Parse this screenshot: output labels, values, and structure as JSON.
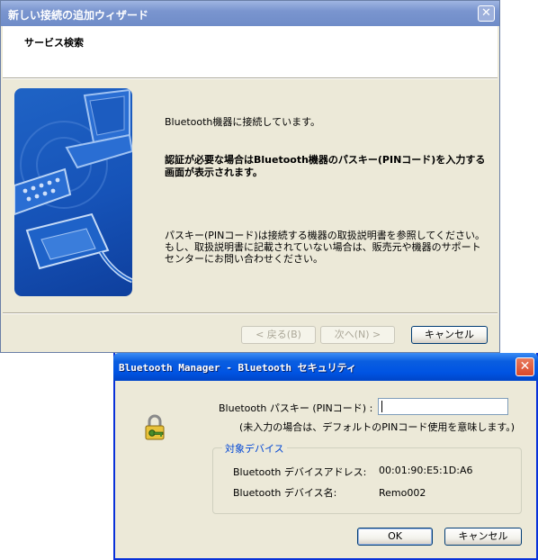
{
  "wizard": {
    "title": "新しい接続の追加ウィザード",
    "header_title": "サービス検索",
    "connecting_text": "Bluetooth機器に接続しています。",
    "auth_text": "認証が必要な場合はBluetooth機器のパスキー(PINコード)を入力する画面が表示されます。",
    "passkey_help": "パスキー(PINコード)は接続する機器の取扱説明書を参照してください。もし、取扱説明書に記載されていない場合は、販売元や機器のサポートセンターにお問い合わせください。",
    "back_button": "< 戻る(B)",
    "next_button": "次へ(N) >",
    "cancel_button": "キャンセル"
  },
  "security": {
    "title": "Bluetooth Manager - Bluetooth セキュリティ",
    "passkey_label": "Bluetooth パスキー (PINコード) :",
    "passkey_value": "",
    "note": "(未入力の場合は、デフォルトのPINコード使用を意味します。)",
    "group_label": "対象デバイス",
    "device_address_label": "Bluetooth デバイスアドレス:",
    "device_address": "00:01:90:E5:1D:A6",
    "device_name_label": "Bluetooth デバイス名:",
    "device_name": "Remo002",
    "ok_button": "OK",
    "cancel_button": "キャンセル"
  },
  "icons": {
    "close": "close-icon",
    "lock": "lock-key-icon",
    "wizard_art": "laptop-serial-cable-icon"
  },
  "colors": {
    "inactive_title": "#7a95cf",
    "active_title": "#0054e3",
    "dialog_bg": "#ece9d8",
    "wizard_art_blue": "#1653b8",
    "group_label": "#0046d5"
  }
}
